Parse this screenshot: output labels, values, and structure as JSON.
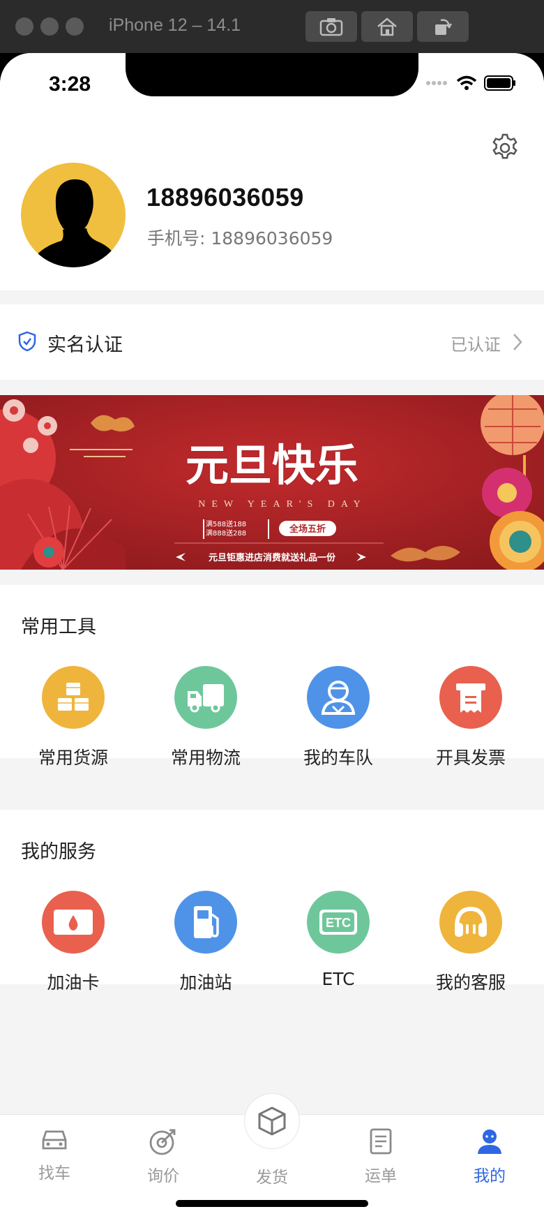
{
  "simulator": {
    "title": "iPhone 12 – 14.1"
  },
  "status_bar": {
    "time": "3:28"
  },
  "profile": {
    "name": "18896036059",
    "phone_label": "手机号: 18896036059"
  },
  "verification": {
    "label": "实名认证",
    "status": "已认证"
  },
  "banner": {
    "title": "元旦快乐",
    "subtitle": "NEW YEAR'S DAY",
    "promo_1": "满588送188",
    "promo_2": "满888送288",
    "promo_badge": "全场五折",
    "tagline": "元旦钜惠进店消费就送礼品一份"
  },
  "tools": {
    "title": "常用工具",
    "items": [
      {
        "label": "常用货源",
        "icon": "boxes-icon",
        "color": "#efb43c"
      },
      {
        "label": "常用物流",
        "icon": "truck-icon",
        "color": "#6ec79b"
      },
      {
        "label": "我的车队",
        "icon": "driver-icon",
        "color": "#4f93e8"
      },
      {
        "label": "开具发票",
        "icon": "invoice-icon",
        "color": "#e9604f"
      }
    ]
  },
  "services": {
    "title": "我的服务",
    "items": [
      {
        "label": "加油卡",
        "icon": "fuel-card-icon",
        "color": "#e9604f"
      },
      {
        "label": "加油站",
        "icon": "gas-station-icon",
        "color": "#4f93e8"
      },
      {
        "label": "ETC",
        "icon": "etc-icon",
        "color": "#6ec79b"
      },
      {
        "label": "我的客服",
        "icon": "headset-icon",
        "color": "#efb43c"
      }
    ]
  },
  "tabbar": {
    "items": [
      {
        "label": "找车",
        "icon": "car-icon",
        "active": false
      },
      {
        "label": "询价",
        "icon": "pricing-icon",
        "active": false
      },
      {
        "label": "发货",
        "icon": "package-icon",
        "active": false
      },
      {
        "label": "运单",
        "icon": "waybill-icon",
        "active": false
      },
      {
        "label": "我的",
        "icon": "user-icon",
        "active": true
      }
    ],
    "active_color": "#2f66e3"
  }
}
